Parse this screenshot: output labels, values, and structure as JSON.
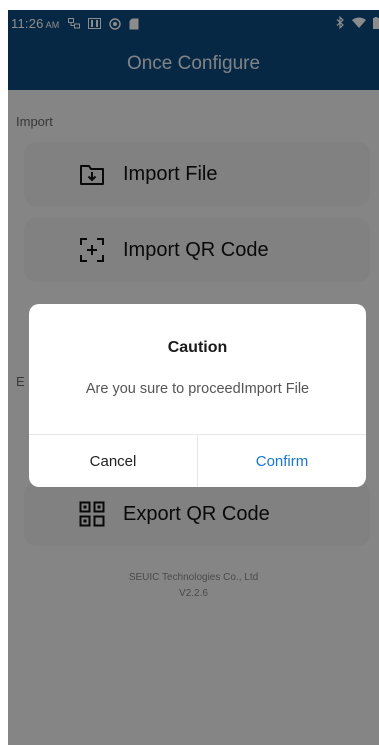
{
  "status_bar": {
    "time": "11:26",
    "ampm": "AM"
  },
  "app_bar": {
    "title": "Once Configure"
  },
  "import_section": {
    "label": "Import",
    "items": [
      {
        "label": "Import File",
        "icon": "folder-import-icon"
      },
      {
        "label": "Import QR Code",
        "icon": "qr-scan-icon"
      }
    ]
  },
  "export_section": {
    "label": "E",
    "items": [
      {
        "label": "Export QR Code",
        "icon": "qr-code-icon"
      }
    ]
  },
  "footer": {
    "company": "SEUIC Technologies Co., Ltd",
    "version": "V2.2.6"
  },
  "dialog": {
    "title": "Caution",
    "message": "Are you sure to proceedImport File",
    "cancel_label": "Cancel",
    "confirm_label": "Confirm"
  },
  "colors": {
    "app_bar": "#0c4a7d",
    "confirm": "#1976d2"
  }
}
